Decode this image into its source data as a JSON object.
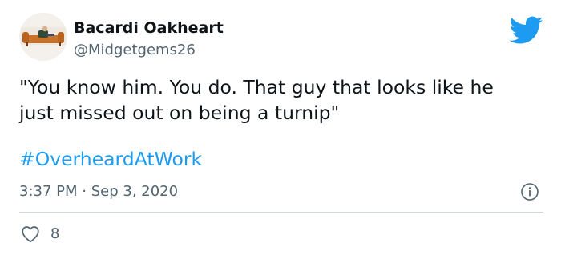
{
  "user": {
    "display_name": "Bacardi Oakheart",
    "handle": "@Midgetgems26",
    "avatar_icon": "avatar-couch-photo"
  },
  "brand": {
    "logo_icon": "twitter-bird-icon",
    "accent_color": "#1d9bf0"
  },
  "tweet": {
    "text_lines": [
      "\"You know him. You do. That guy that looks like he",
      "just missed out on being a turnip\""
    ],
    "hashtag": "#OverheardAtWork",
    "time": "3:37 PM",
    "separator": "·",
    "date": "Sep 3, 2020"
  },
  "engagement": {
    "likes": "8",
    "like_icon": "heart-outline-icon",
    "info_icon": "info-icon"
  }
}
